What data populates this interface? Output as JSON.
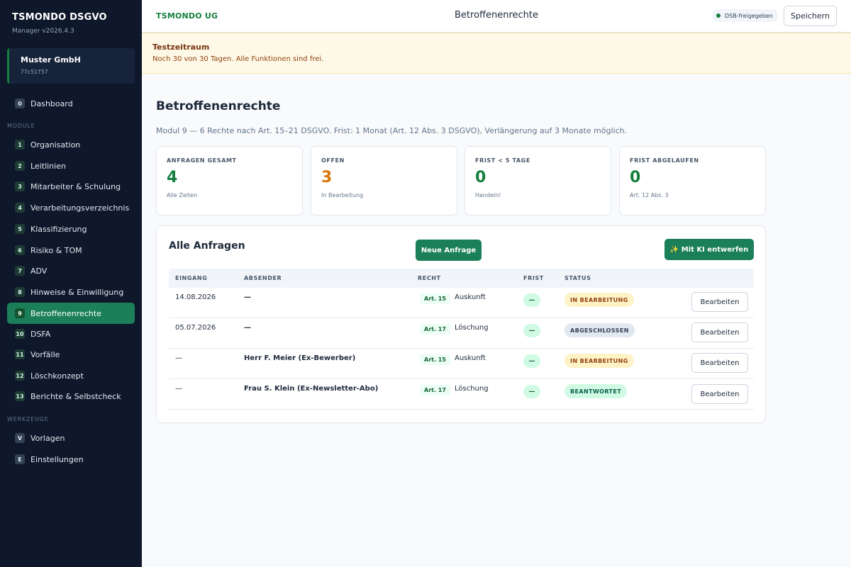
{
  "sidebar": {
    "brand": "TSMONDO DSGVO",
    "version": "Manager v2026.4.3",
    "org": {
      "name": "Muster GmbH",
      "id": "77c51f57"
    },
    "dashboard": {
      "badge": "0",
      "label": "Dashboard"
    },
    "module_label": "MODULE",
    "modules": [
      {
        "badge": "1",
        "label": "Organisation"
      },
      {
        "badge": "2",
        "label": "Leitlinien"
      },
      {
        "badge": "3",
        "label": "Mitarbeiter & Schulung"
      },
      {
        "badge": "4",
        "label": "Verarbeitungsverzeichnis"
      },
      {
        "badge": "5",
        "label": "Klassifizierung"
      },
      {
        "badge": "6",
        "label": "Risiko & TOM"
      },
      {
        "badge": "7",
        "label": "ADV"
      },
      {
        "badge": "8",
        "label": "Hinweise & Einwilligung"
      },
      {
        "badge": "9",
        "label": "Betroffenenrechte"
      },
      {
        "badge": "10",
        "label": "DSFA"
      },
      {
        "badge": "11",
        "label": "Vorfälle"
      },
      {
        "badge": "12",
        "label": "Löschkonzept"
      },
      {
        "badge": "13",
        "label": "Berichte & Selbstcheck"
      }
    ],
    "tools_label": "WERKZEUGE",
    "tools": [
      {
        "badge": "V",
        "label": "Vorlagen"
      },
      {
        "badge": "E",
        "label": "Einstellungen"
      }
    ],
    "active_module": "Betroffenenrechte"
  },
  "topbar": {
    "company": "TSMONDO UG",
    "title": "Betroffenenrechte",
    "dsb_status": "DSB-freigegeben",
    "save_label": "Speichern"
  },
  "trial": {
    "title": "Testzeitraum",
    "text": "Noch 30 von 30 Tagen. Alle Funktionen sind frei."
  },
  "main": {
    "title": "Betroffenenrechte",
    "description": "Modul 9 — 6 Rechte nach Art. 15–21 DSGVO. Frist: 1 Monat (Art. 12 Abs. 3 DSGVO), Verlängerung auf 3 Monate möglich.",
    "stats": [
      {
        "label": "ANFRAGEN GESAMT",
        "value": "4",
        "sub": "Alle Zeiten"
      },
      {
        "label": "OFFEN",
        "value": "3",
        "sub": "In Bearbeitung"
      },
      {
        "label": "FRIST < 5 TAGE",
        "value": "0",
        "sub": "Handeln!"
      },
      {
        "label": "FRIST ABGELAUFEN",
        "value": "0",
        "sub": "Art. 12 Abs. 3"
      }
    ],
    "requests": {
      "title": "Alle Anfragen",
      "new_button": "Neue Anfrage",
      "ai_button": "✨ Mit KI entwerfen",
      "columns": [
        "EINGANG",
        "ABSENDER",
        "RECHT",
        "FRIST",
        "STATUS"
      ],
      "edit_label": "Bearbeiten",
      "rows": [
        {
          "eingang": "14.08.2026",
          "absender": "—",
          "art": "Art. 15",
          "recht": "Auskunft",
          "frist": "—",
          "status": "IN BEARBEITUNG"
        },
        {
          "eingang": "05.07.2026",
          "absender": "—",
          "art": "Art. 17",
          "recht": "Löschung",
          "frist": "—",
          "status": "ABGESCHLOSSEN"
        },
        {
          "eingang": "—",
          "absender": "Herr F. Meier (Ex-Bewerber)",
          "art": "Art. 15",
          "recht": "Auskunft",
          "frist": "—",
          "status": "IN BEARBEITUNG"
        },
        {
          "eingang": "—",
          "absender": "Frau S. Klein (Ex-Newsletter-Abo)",
          "art": "Art. 17",
          "recht": "Löschung",
          "frist": "—",
          "status": "BEANTWORTET"
        }
      ]
    }
  },
  "colors": {
    "sidebar_bg": "#0f172a",
    "accent_green": "#1b7f5a",
    "brand_green": "#15803d",
    "warning_orange": "#d97706",
    "trial_bg": "#fef9e7"
  }
}
